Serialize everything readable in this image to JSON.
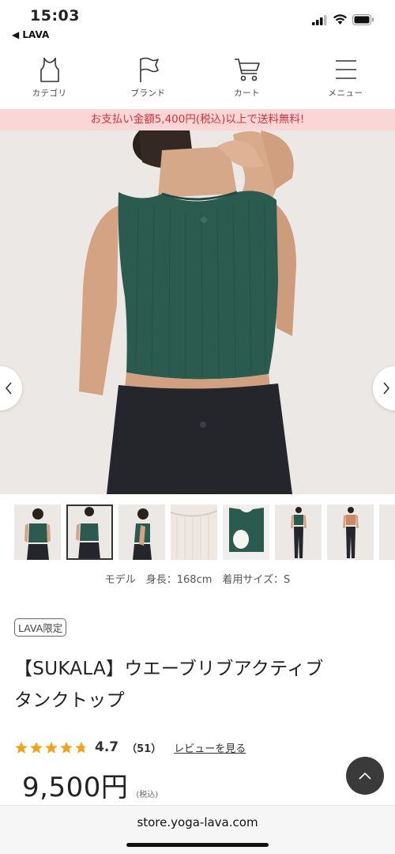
{
  "status": {
    "time": "15:03",
    "back_app": "◀ LAVA"
  },
  "nav": {
    "items": [
      {
        "label": "カテゴリ",
        "icon": "tank-top-icon"
      },
      {
        "label": "ブランド",
        "icon": "flag-icon"
      },
      {
        "label": "カート",
        "icon": "cart-icon"
      },
      {
        "label": "メニュー",
        "icon": "hamburger-menu-icon"
      }
    ]
  },
  "promo": {
    "text": "お支払い金額5,400円(税込)以上で送料無料!"
  },
  "colors": {
    "promo_bg": "#fbd6d6",
    "promo_text": "#d0333a",
    "top_green": "#2b5a4f",
    "star": "#f2a31c"
  },
  "model_info": "モデル　身長：168cm　着用サイズ：S",
  "badge": "LAVA限定",
  "product": {
    "title_line1": "【SUKALA】ウエーブリブアクティブ",
    "title_line2": "タンクトップ",
    "rating": 4.7,
    "rating_text": "4.7",
    "review_count": "（51）",
    "review_link": "レビューを見る",
    "price": "9,500円",
    "tax_note": "(税込)"
  },
  "url": "store.yoga-lava.com"
}
